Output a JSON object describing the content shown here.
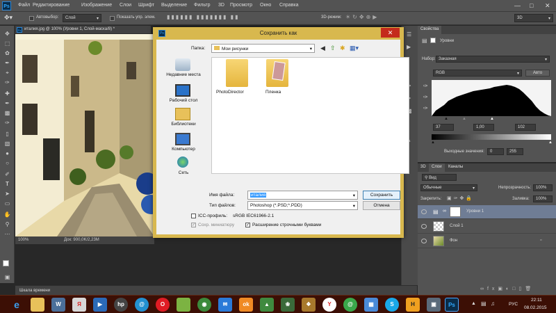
{
  "menubar": {
    "logo": "Ps",
    "items": [
      "Файл",
      "Редактирование",
      "Изображение",
      "Слои",
      "Шрифт",
      "Выделение",
      "Фильтр",
      "3D",
      "Просмотр",
      "Окно",
      "Справка"
    ]
  },
  "options": {
    "autoselect_label": "Автовыбор:",
    "autoselect_value": "Слой",
    "show_controls_label": "Показать упр. элем.",
    "mode_3d": "3D-режим:",
    "workspace": "3D"
  },
  "document": {
    "tab_title": "италия.jpg @ 100% (Уровни 1, Слой-маска/8) *",
    "zoom": "100%",
    "doc_info": "Док: 900,0K/2,23M"
  },
  "timeline": {
    "label": "Шкала времени"
  },
  "dialog": {
    "title": "Сохранить как",
    "folder_label": "Папка:",
    "folder_value": "Мои рисунки",
    "places": [
      "Недавние места",
      "Рабочий стол",
      "Библиотеки",
      "Компьютер",
      "Сеть"
    ],
    "files": [
      "PhotoDirector",
      "Пленка"
    ],
    "filename_label": "Имя файла:",
    "filename_value": "италия",
    "filetype_label": "Тип файлов:",
    "filetype_value": "Photoshop (*.PSD;*.PDD)",
    "save_button": "Сохранить",
    "cancel_button": "Отмена",
    "icc_label": "ICC-профиль:",
    "icc_value": "sRGB IEC61966-2.1",
    "thumbnail_label": "Сохр. миниатюру",
    "lowercase_ext_label": "Расширение строчными буквами",
    "thumbnail_checked": true,
    "lowercase_checked": true
  },
  "properties": {
    "tab": "Свойства",
    "panel_title": "Уровни",
    "preset_label": "Набор:",
    "preset_value": "Заказная",
    "channel_value": "RGB",
    "auto_button": "Авто",
    "input_black": "37",
    "input_gamma": "1,00",
    "input_white": "102",
    "output_label": "Выходные значения:",
    "output_black": "0",
    "output_white": "255"
  },
  "layers_panel": {
    "tabs": [
      "3D",
      "Слои",
      "Каналы"
    ],
    "filter_value": "Вид",
    "blend_mode": "Обычные",
    "opacity_label": "Непрозрачность:",
    "opacity_value": "100%",
    "lock_label": "Закрепить:",
    "fill_label": "Заливка:",
    "fill_value": "100%",
    "layers": [
      {
        "name": "Уровни 1",
        "selected": true
      },
      {
        "name": "Слой 1",
        "selected": false
      },
      {
        "name": "Фон",
        "selected": false
      }
    ]
  },
  "taskbar": {
    "language": "РУС",
    "time": "22:11",
    "date": "08.02.2015"
  },
  "colors": {
    "dialog_frame": "#d8b84e",
    "taskbar": "#3c0f05",
    "ui_panel": "#535353",
    "close_red": "#c42b1c"
  }
}
